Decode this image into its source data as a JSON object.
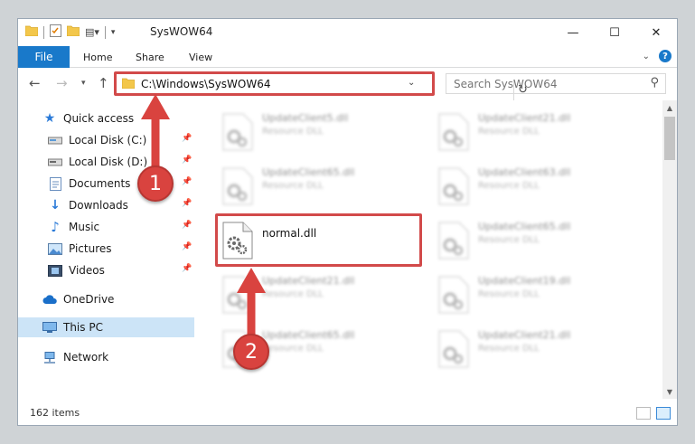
{
  "window": {
    "title": "SysWOW64"
  },
  "ribbon": {
    "file": "File",
    "tabs": [
      "Home",
      "Share",
      "View"
    ]
  },
  "navbar": {
    "address": "C:\\Windows\\SysWOW64",
    "search_placeholder": "Search SysWOW64"
  },
  "navpane": {
    "quick_access": "Quick access",
    "items": [
      {
        "label": "Local Disk (C:)",
        "icon": "drive-icon"
      },
      {
        "label": "Local Disk (D:)",
        "icon": "drive-icon"
      },
      {
        "label": "Documents",
        "icon": "documents-icon"
      },
      {
        "label": "Downloads",
        "icon": "download-icon"
      },
      {
        "label": "Music",
        "icon": "music-icon"
      },
      {
        "label": "Pictures",
        "icon": "pictures-icon"
      },
      {
        "label": "Videos",
        "icon": "videos-icon"
      }
    ],
    "onedrive": "OneDrive",
    "this_pc": "This PC",
    "network": "Network"
  },
  "files": [
    {
      "name": "UpdateClient5.dll",
      "type": "Resource DLL"
    },
    {
      "name": "UpdateClient21.dll",
      "type": "Resource DLL"
    },
    {
      "name": "UpdateClient65.dll",
      "type": "Resource DLL"
    },
    {
      "name": "UpdateClient63.dll",
      "type": "Resource DLL"
    },
    {
      "name": "normal.dll",
      "type": ""
    },
    {
      "name": "UpdateClient65.dll",
      "type": "Resource DLL"
    },
    {
      "name": "UpdateClient21.dll",
      "type": "Resource DLL"
    },
    {
      "name": "UpdateClient19.dll",
      "type": "Resource DLL"
    },
    {
      "name": "UpdateClient65.dll",
      "type": "Resource DLL"
    },
    {
      "name": "UpdateClient21.dll",
      "type": "Resource DLL"
    }
  ],
  "status": {
    "count": "162 items"
  },
  "annotations": {
    "step1": "1",
    "step2": "2",
    "color": "#d9433f"
  }
}
